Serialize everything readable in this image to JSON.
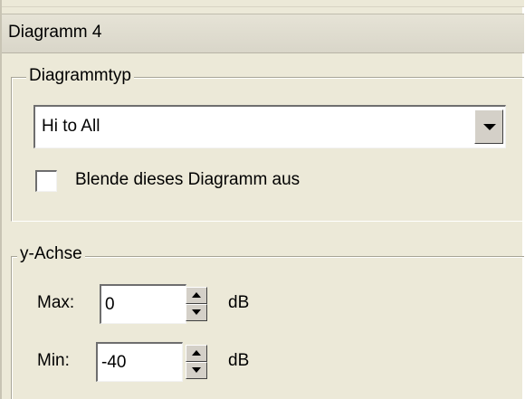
{
  "header": {
    "title": "Diagramm 4"
  },
  "diagram_type_group": {
    "legend": "Diagrammtyp",
    "type_select": {
      "selected": "Hi to All"
    },
    "hide_checkbox": {
      "label": "Blende dieses Diagramm aus",
      "checked": false
    }
  },
  "y_axis_group": {
    "legend": "y-Achse",
    "max": {
      "label": "Max:",
      "value": "0",
      "unit": "dB"
    },
    "min": {
      "label": "Min:",
      "value": "-40",
      "unit": "dB"
    }
  }
}
